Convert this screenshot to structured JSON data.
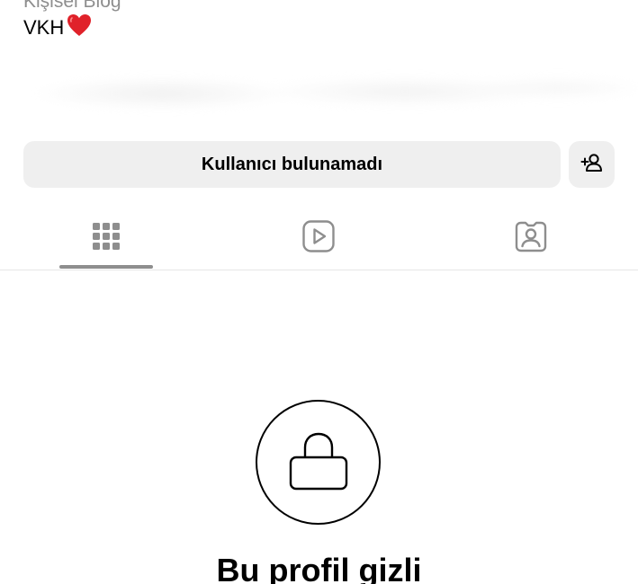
{
  "profile": {
    "category": "Kişisel Blog",
    "bio": "VKH",
    "bio_emoji_icon": "red-heart-icon"
  },
  "actions": {
    "status_label": "Kullanıcı bulunamadı",
    "add_user_icon": "add-user-icon"
  },
  "tabs": [
    {
      "name": "posts",
      "icon": "grid-icon",
      "active": true
    },
    {
      "name": "reels",
      "icon": "play-icon",
      "active": false
    },
    {
      "name": "tagged",
      "icon": "tagged-person-icon",
      "active": false
    }
  ],
  "private_notice": {
    "icon": "lock-icon",
    "title": "Bu profil gizli"
  },
  "colors": {
    "button_bg": "#efefef",
    "muted_text": "#8e8e8e",
    "heart": "#e0222a"
  }
}
